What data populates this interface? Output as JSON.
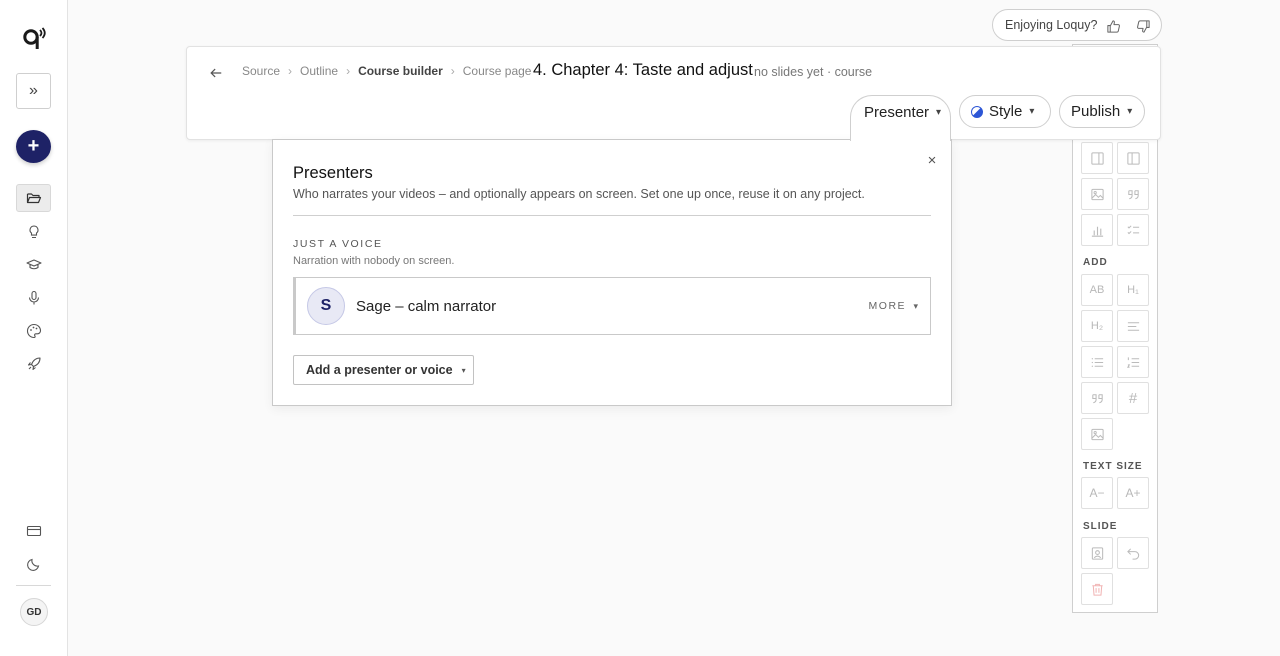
{
  "app": {
    "name": "Loquy"
  },
  "rail": {
    "logo_icon": "loquy-logo-icon",
    "expand_icon": "chevrons-right-icon",
    "new_label": "+",
    "items": [
      {
        "name": "projects",
        "icon": "folder-open-icon",
        "active": true
      },
      {
        "name": "ideas",
        "icon": "lightbulb-icon",
        "active": false
      },
      {
        "name": "courses",
        "icon": "graduation-cap-icon",
        "active": false
      },
      {
        "name": "voice",
        "icon": "microphone-icon",
        "active": false
      },
      {
        "name": "brand",
        "icon": "palette-icon",
        "active": false
      },
      {
        "name": "publish",
        "icon": "rocket-icon",
        "active": false
      }
    ],
    "billing_icon": "credit-card-icon",
    "theme_icon": "moon-icon",
    "avatar_initials": "GD"
  },
  "feedback": {
    "label": "Enjoying Loquy?",
    "like_icon": "thumbs-up-icon",
    "dislike_icon": "thumbs-down-icon"
  },
  "header": {
    "back_icon": "arrow-left-icon",
    "breadcrumbs": [
      {
        "label": "Source",
        "current": false
      },
      {
        "label": "Outline",
        "current": false
      },
      {
        "label": "Course builder",
        "current": true
      },
      {
        "label": "Course page",
        "current": false
      }
    ],
    "breadcrumb_sep": "›",
    "title": "4. Chapter 4: Taste and adjust",
    "subtitle": "no slides yet · course",
    "presenter_label": "Presenter",
    "style_label": "Style",
    "publish_label": "Publish",
    "caret": "▾"
  },
  "presenters_popover": {
    "title": "Presenters",
    "description": "Who narrates your videos – and optionally appears on screen. Set one up once, reuse it on any project.",
    "close_label": "×",
    "section_title": "JUST A VOICE",
    "section_subtitle": "Narration with nobody on screen.",
    "voices": [
      {
        "initial": "S",
        "name": "Sage – calm narrator",
        "more_label": "MORE"
      }
    ],
    "add_button_label": "Add a presenter or voice"
  },
  "toolbox": {
    "layout_tools": [
      "layout-right-panel-icon",
      "layout-left-panel-icon",
      "image-icon",
      "quote-icon",
      "bar-chart-icon",
      "checklist-icon"
    ],
    "add_label": "ADD",
    "add_tools": [
      {
        "icon": "text-ab-icon",
        "text": "AB"
      },
      {
        "icon": "heading-1-icon",
        "text": "H₁"
      },
      {
        "icon": "heading-2-icon",
        "text": "H₂"
      },
      {
        "icon": "paragraph-icon",
        "text": ""
      },
      {
        "icon": "bullet-list-icon",
        "text": ""
      },
      {
        "icon": "numbered-list-icon",
        "text": ""
      },
      {
        "icon": "quote-icon",
        "text": ""
      },
      {
        "icon": "hash-icon",
        "text": "#"
      },
      {
        "icon": "image-icon",
        "text": ""
      }
    ],
    "text_size_label": "TEXT SIZE",
    "text_size_tools": [
      {
        "icon": "decrease-text-icon",
        "text": "A−"
      },
      {
        "icon": "increase-text-icon",
        "text": "A+"
      }
    ],
    "slide_label": "SLIDE",
    "slide_tools": [
      "portrait-icon",
      "undo-icon",
      "trash-icon"
    ]
  },
  "colors": {
    "accent": "#1e2266",
    "style_dot": "#2d56d6",
    "danger": "#f1b4b4"
  }
}
